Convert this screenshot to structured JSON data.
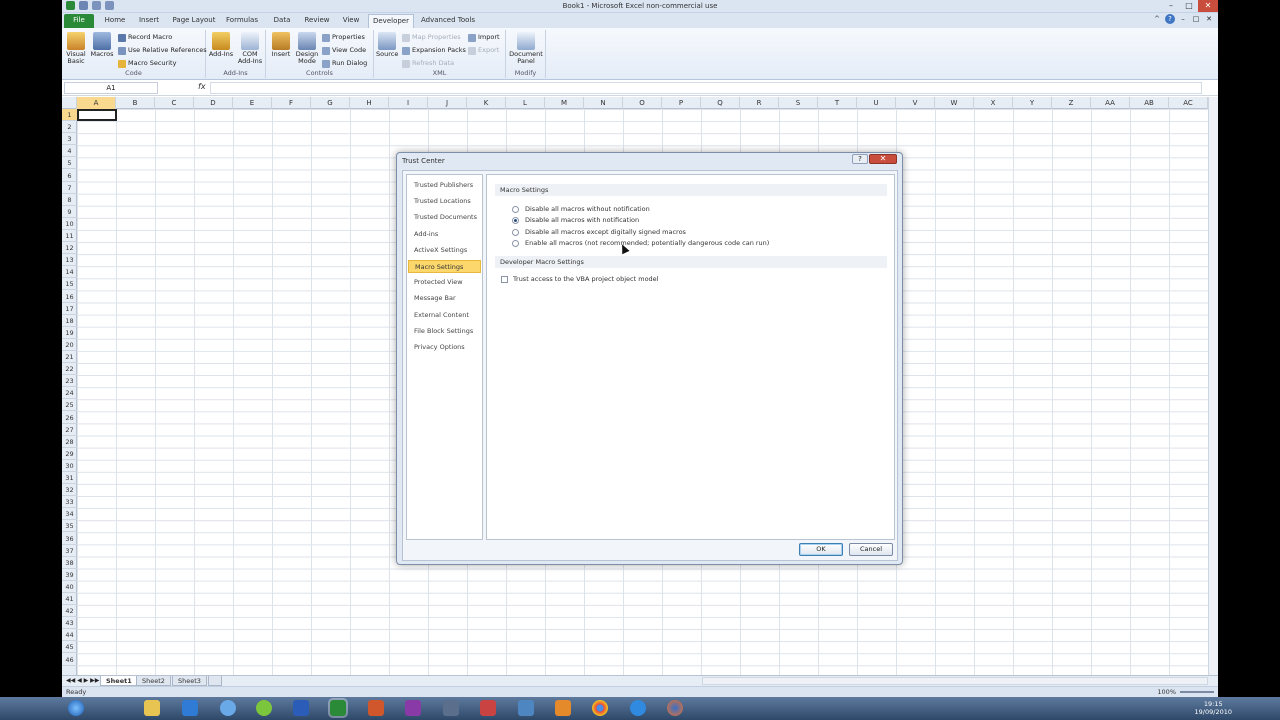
{
  "window": {
    "title": "Book1 - Microsoft Excel non-commercial use"
  },
  "ribbon_tabs": [
    "File",
    "Home",
    "Insert",
    "Page Layout",
    "Formulas",
    "Data",
    "Review",
    "View",
    "Developer",
    "Advanced Tools"
  ],
  "ribbon": {
    "code": {
      "label": "Code",
      "visual_basic": "Visual Basic",
      "macros": "Macros",
      "record_macro": "Record Macro",
      "relative_refs": "Use Relative References",
      "macro_security": "Macro Security"
    },
    "addins": {
      "label": "Add-Ins",
      "addins": "Add-Ins",
      "com_addins": "COM Add-Ins"
    },
    "controls": {
      "label": "Controls",
      "insert": "Insert",
      "design_mode": "Design Mode",
      "properties": "Properties",
      "view_code": "View Code",
      "run_dialog": "Run Dialog"
    },
    "xml": {
      "label": "XML",
      "source": "Source",
      "map_properties": "Map Properties",
      "expansion_packs": "Expansion Packs",
      "refresh_data": "Refresh Data",
      "import": "Import",
      "export": "Export"
    },
    "modify": {
      "label": "Modify",
      "document_panel": "Document Panel"
    }
  },
  "formula_bar": {
    "name_box": "A1",
    "fx": "fx",
    "value": ""
  },
  "columns": [
    "A",
    "B",
    "C",
    "D",
    "E",
    "F",
    "G",
    "H",
    "I",
    "J",
    "K",
    "L",
    "M",
    "N",
    "O",
    "P",
    "Q",
    "R",
    "S",
    "T",
    "U",
    "V",
    "W",
    "X",
    "Y",
    "Z",
    "AA",
    "AB",
    "AC"
  ],
  "selected_column": "A",
  "selected_row": 1,
  "row_count": 46,
  "sheets": [
    "Sheet1",
    "Sheet2",
    "Sheet3"
  ],
  "status": {
    "mode": "Ready",
    "zoom": "100%"
  },
  "dialog": {
    "title": "Trust Center",
    "nav": [
      "Trusted Publishers",
      "Trusted Locations",
      "Trusted Documents",
      "Add-ins",
      "ActiveX Settings",
      "Macro Settings",
      "Protected View",
      "Message Bar",
      "External Content",
      "File Block Settings",
      "Privacy Options"
    ],
    "active_nav": "Macro Settings",
    "macro_heading": "Macro Settings",
    "options": [
      "Disable all macros without notification",
      "Disable all macros with notification",
      "Disable all macros except digitally signed macros",
      "Enable all macros (not recommended; potentially dangerous code can run)"
    ],
    "selected_option": 1,
    "dev_heading": "Developer Macro Settings",
    "trust_vba": "Trust access to the VBA project object model",
    "ok": "OK",
    "cancel": "Cancel"
  },
  "taskbar": {
    "time": "19:15",
    "date": "19/09/2010"
  },
  "colors": {
    "accent": "#2a8a38",
    "selection": "#fbd76c",
    "ribbon": "#dbe5f1"
  }
}
